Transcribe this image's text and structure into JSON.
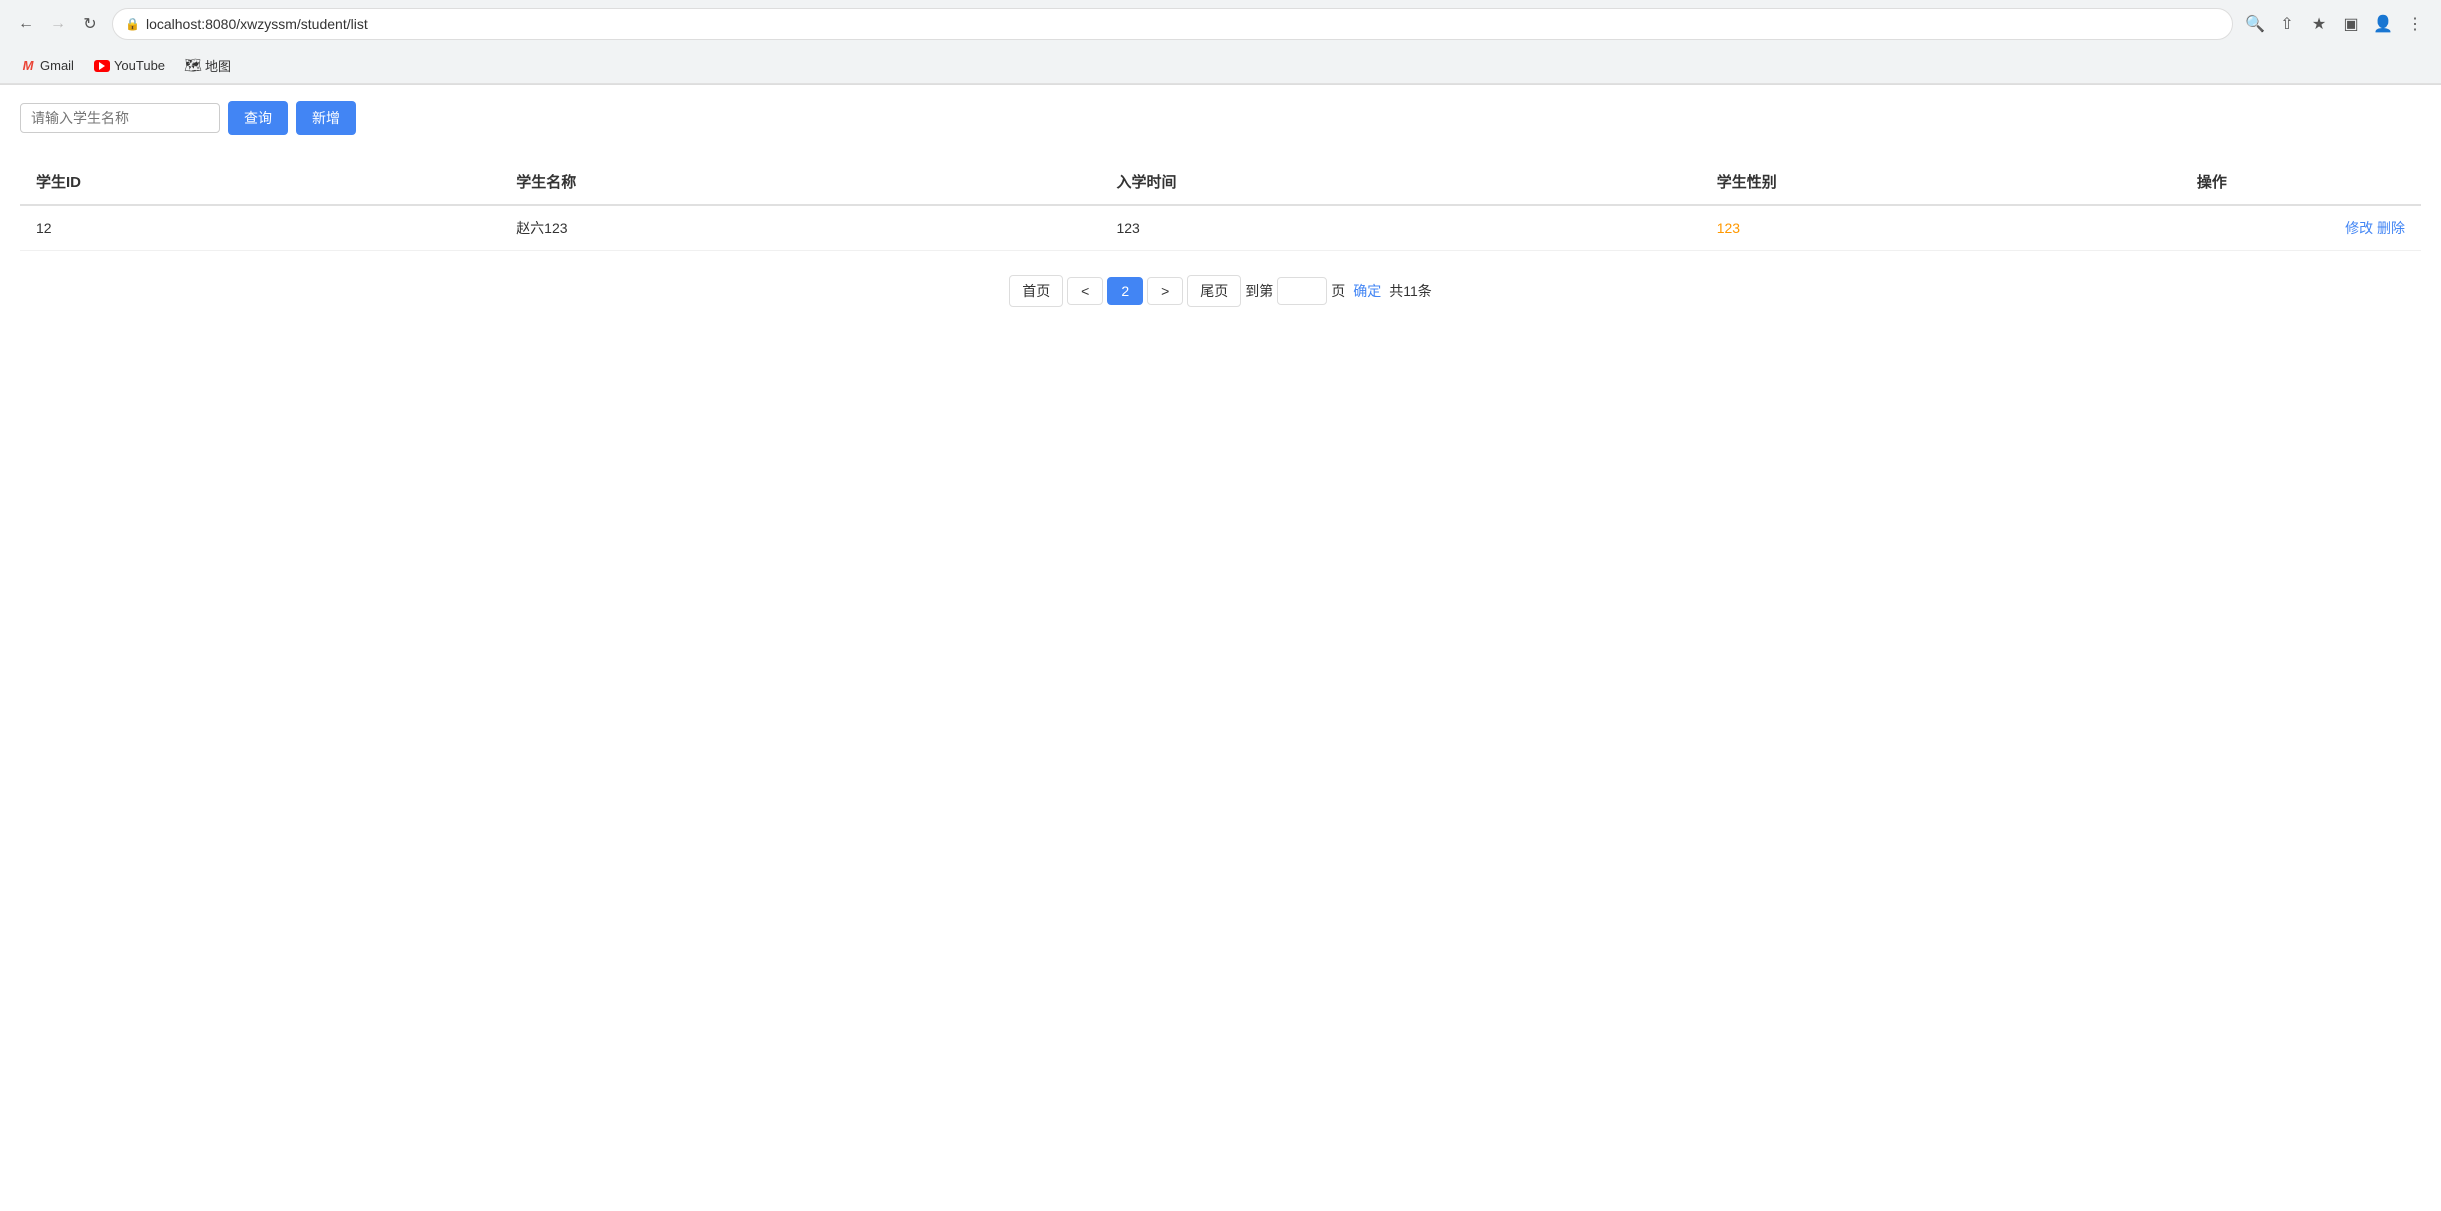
{
  "browser": {
    "url": "localhost:8080/xwzyssm/student/list",
    "back_disabled": false,
    "forward_disabled": false,
    "bookmarks": [
      {
        "id": "gmail",
        "label": "Gmail",
        "icon": "gmail"
      },
      {
        "id": "youtube",
        "label": "YouTube",
        "icon": "youtube"
      },
      {
        "id": "maps",
        "label": "地图",
        "icon": "maps"
      }
    ]
  },
  "toolbar": {
    "search_placeholder": "请输入学生名称",
    "query_label": "查询",
    "add_label": "新增"
  },
  "table": {
    "columns": [
      {
        "key": "id",
        "label": "学生ID"
      },
      {
        "key": "name",
        "label": "学生名称"
      },
      {
        "key": "enrollment_time",
        "label": "入学时间"
      },
      {
        "key": "gender",
        "label": "学生性别"
      },
      {
        "key": "action",
        "label": "操作"
      }
    ],
    "rows": [
      {
        "id": "12",
        "name": "赵六123",
        "enrollment_time": "123",
        "gender": "123",
        "edit_label": "修改",
        "delete_label": "删除"
      }
    ]
  },
  "pagination": {
    "first_label": "首页",
    "prev_label": "<",
    "next_label": ">",
    "last_label": "尾页",
    "goto_label": "到第",
    "page_suffix": "页",
    "confirm_label": "确定",
    "total_text": "共11条",
    "current_page": "2"
  }
}
